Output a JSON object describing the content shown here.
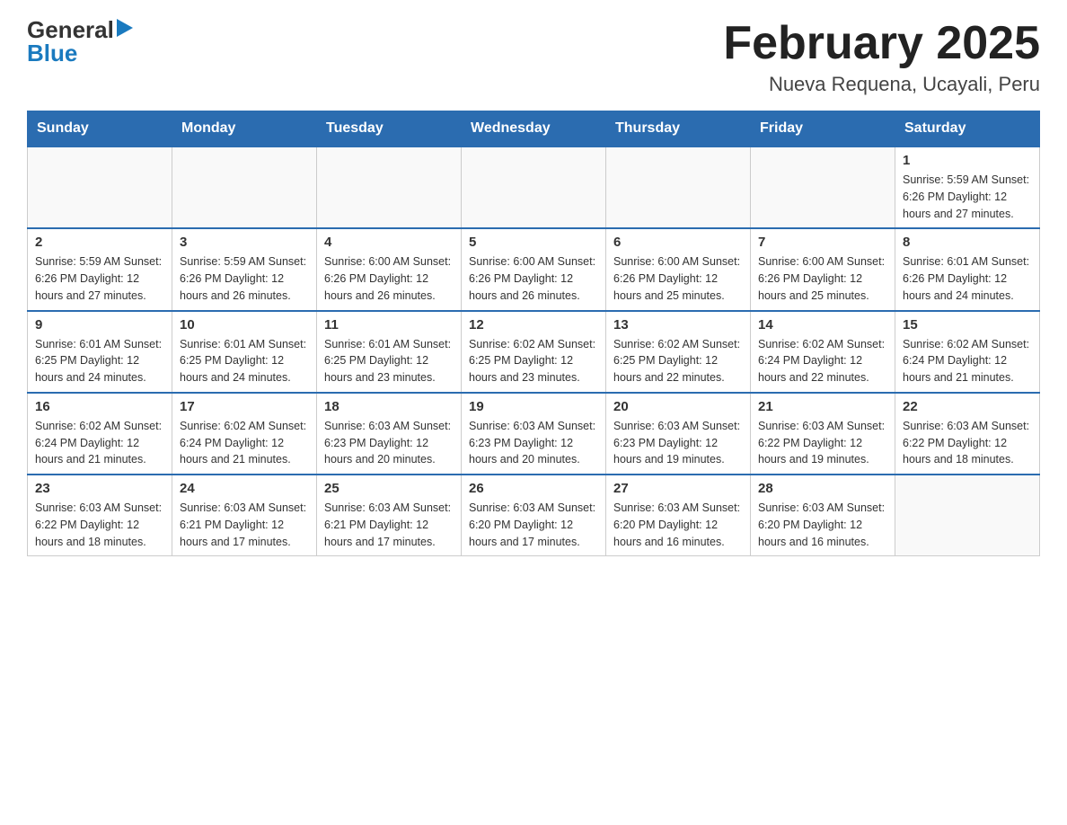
{
  "header": {
    "logo_general": "General",
    "logo_blue": "Blue",
    "month_year": "February 2025",
    "location": "Nueva Requena, Ucayali, Peru"
  },
  "weekdays": [
    "Sunday",
    "Monday",
    "Tuesday",
    "Wednesday",
    "Thursday",
    "Friday",
    "Saturday"
  ],
  "weeks": [
    [
      {
        "day": "",
        "info": ""
      },
      {
        "day": "",
        "info": ""
      },
      {
        "day": "",
        "info": ""
      },
      {
        "day": "",
        "info": ""
      },
      {
        "day": "",
        "info": ""
      },
      {
        "day": "",
        "info": ""
      },
      {
        "day": "1",
        "info": "Sunrise: 5:59 AM\nSunset: 6:26 PM\nDaylight: 12 hours\nand 27 minutes."
      }
    ],
    [
      {
        "day": "2",
        "info": "Sunrise: 5:59 AM\nSunset: 6:26 PM\nDaylight: 12 hours\nand 27 minutes."
      },
      {
        "day": "3",
        "info": "Sunrise: 5:59 AM\nSunset: 6:26 PM\nDaylight: 12 hours\nand 26 minutes."
      },
      {
        "day": "4",
        "info": "Sunrise: 6:00 AM\nSunset: 6:26 PM\nDaylight: 12 hours\nand 26 minutes."
      },
      {
        "day": "5",
        "info": "Sunrise: 6:00 AM\nSunset: 6:26 PM\nDaylight: 12 hours\nand 26 minutes."
      },
      {
        "day": "6",
        "info": "Sunrise: 6:00 AM\nSunset: 6:26 PM\nDaylight: 12 hours\nand 25 minutes."
      },
      {
        "day": "7",
        "info": "Sunrise: 6:00 AM\nSunset: 6:26 PM\nDaylight: 12 hours\nand 25 minutes."
      },
      {
        "day": "8",
        "info": "Sunrise: 6:01 AM\nSunset: 6:26 PM\nDaylight: 12 hours\nand 24 minutes."
      }
    ],
    [
      {
        "day": "9",
        "info": "Sunrise: 6:01 AM\nSunset: 6:25 PM\nDaylight: 12 hours\nand 24 minutes."
      },
      {
        "day": "10",
        "info": "Sunrise: 6:01 AM\nSunset: 6:25 PM\nDaylight: 12 hours\nand 24 minutes."
      },
      {
        "day": "11",
        "info": "Sunrise: 6:01 AM\nSunset: 6:25 PM\nDaylight: 12 hours\nand 23 minutes."
      },
      {
        "day": "12",
        "info": "Sunrise: 6:02 AM\nSunset: 6:25 PM\nDaylight: 12 hours\nand 23 minutes."
      },
      {
        "day": "13",
        "info": "Sunrise: 6:02 AM\nSunset: 6:25 PM\nDaylight: 12 hours\nand 22 minutes."
      },
      {
        "day": "14",
        "info": "Sunrise: 6:02 AM\nSunset: 6:24 PM\nDaylight: 12 hours\nand 22 minutes."
      },
      {
        "day": "15",
        "info": "Sunrise: 6:02 AM\nSunset: 6:24 PM\nDaylight: 12 hours\nand 21 minutes."
      }
    ],
    [
      {
        "day": "16",
        "info": "Sunrise: 6:02 AM\nSunset: 6:24 PM\nDaylight: 12 hours\nand 21 minutes."
      },
      {
        "day": "17",
        "info": "Sunrise: 6:02 AM\nSunset: 6:24 PM\nDaylight: 12 hours\nand 21 minutes."
      },
      {
        "day": "18",
        "info": "Sunrise: 6:03 AM\nSunset: 6:23 PM\nDaylight: 12 hours\nand 20 minutes."
      },
      {
        "day": "19",
        "info": "Sunrise: 6:03 AM\nSunset: 6:23 PM\nDaylight: 12 hours\nand 20 minutes."
      },
      {
        "day": "20",
        "info": "Sunrise: 6:03 AM\nSunset: 6:23 PM\nDaylight: 12 hours\nand 19 minutes."
      },
      {
        "day": "21",
        "info": "Sunrise: 6:03 AM\nSunset: 6:22 PM\nDaylight: 12 hours\nand 19 minutes."
      },
      {
        "day": "22",
        "info": "Sunrise: 6:03 AM\nSunset: 6:22 PM\nDaylight: 12 hours\nand 18 minutes."
      }
    ],
    [
      {
        "day": "23",
        "info": "Sunrise: 6:03 AM\nSunset: 6:22 PM\nDaylight: 12 hours\nand 18 minutes."
      },
      {
        "day": "24",
        "info": "Sunrise: 6:03 AM\nSunset: 6:21 PM\nDaylight: 12 hours\nand 17 minutes."
      },
      {
        "day": "25",
        "info": "Sunrise: 6:03 AM\nSunset: 6:21 PM\nDaylight: 12 hours\nand 17 minutes."
      },
      {
        "day": "26",
        "info": "Sunrise: 6:03 AM\nSunset: 6:20 PM\nDaylight: 12 hours\nand 17 minutes."
      },
      {
        "day": "27",
        "info": "Sunrise: 6:03 AM\nSunset: 6:20 PM\nDaylight: 12 hours\nand 16 minutes."
      },
      {
        "day": "28",
        "info": "Sunrise: 6:03 AM\nSunset: 6:20 PM\nDaylight: 12 hours\nand 16 minutes."
      },
      {
        "day": "",
        "info": ""
      }
    ]
  ]
}
